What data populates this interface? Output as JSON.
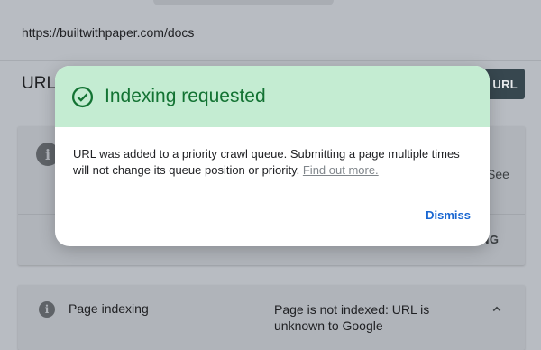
{
  "background": {
    "url": "https://builtwithpaper.com/docs",
    "heading_partial": "URL i",
    "request_indexing_partial": "E URL",
    "card1": {
      "see_partial": "See",
      "request_indexing_partial": "XING"
    },
    "page_indexing": {
      "label": "Page indexing",
      "status": "Page is not indexed: URL is unknown to Google"
    }
  },
  "dialog": {
    "title": "Indexing requested",
    "body_text": "URL was added to a priority crawl queue. Submitting a page multiple times will not change its queue position or priority.",
    "link_text": "Find out more.",
    "dismiss_label": "Dismiss",
    "colors": {
      "header_bg": "#c4ecd2",
      "title_green": "#137333",
      "link_blue": "#1967d2"
    }
  },
  "icons": {
    "success": "check-circle-icon",
    "info": "info-icon",
    "collapse": "chevron-up-icon"
  }
}
